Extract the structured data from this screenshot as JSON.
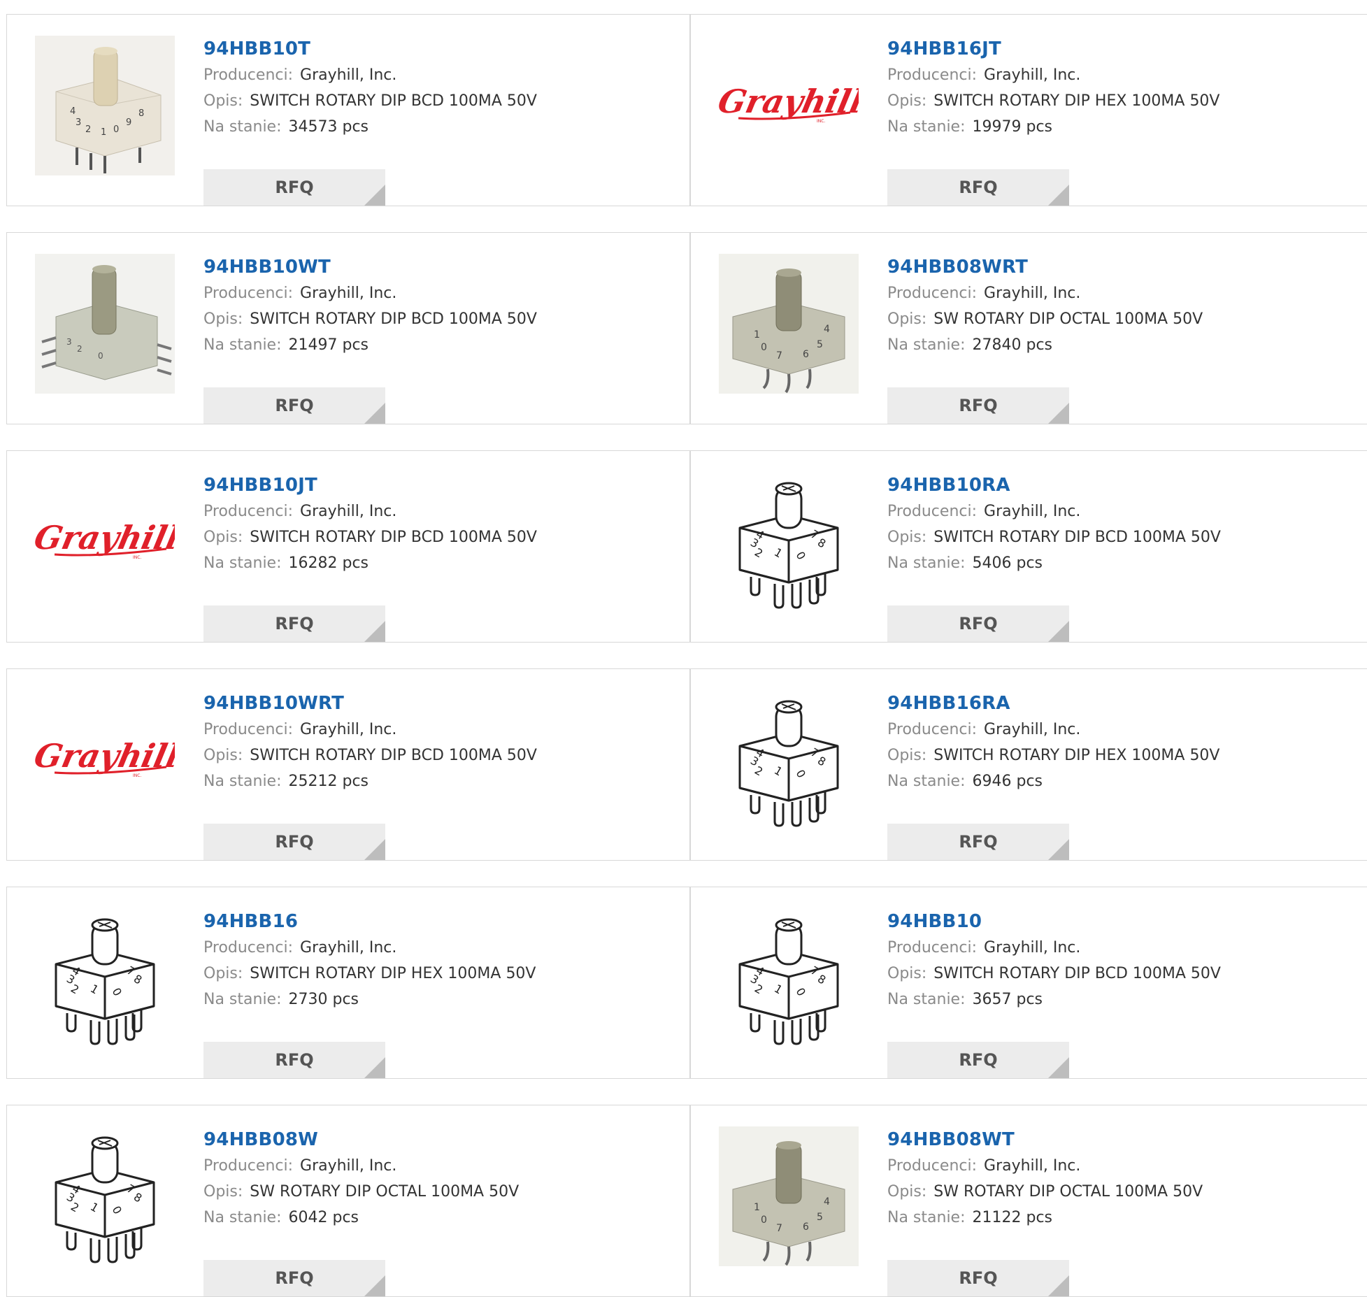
{
  "labels": {
    "manufacturer": "Producenci:",
    "description": "Opis:",
    "stock": "Na stanie:",
    "rfq": "RFQ"
  },
  "products": [
    {
      "part": "94HBB10T",
      "manufacturer": "Grayhill, Inc.",
      "description": "SWITCH ROTARY DIP BCD 100MA 50V",
      "stock": "34573 pcs",
      "image": "photo-beige-switch"
    },
    {
      "part": "94HBB16JT",
      "manufacturer": "Grayhill, Inc.",
      "description": "SWITCH ROTARY DIP HEX 100MA 50V",
      "stock": "19979 pcs",
      "image": "grayhill-logo"
    },
    {
      "part": "94HBB10WT",
      "manufacturer": "Grayhill, Inc.",
      "description": "SWITCH ROTARY DIP BCD 100MA 50V",
      "stock": "21497 pcs",
      "image": "photo-gray-smd-switch"
    },
    {
      "part": "94HBB08WRT",
      "manufacturer": "Grayhill, Inc.",
      "description": "SW ROTARY DIP OCTAL 100MA 50V",
      "stock": "27840 pcs",
      "image": "photo-gray-switch"
    },
    {
      "part": "94HBB10JT",
      "manufacturer": "Grayhill, Inc.",
      "description": "SWITCH ROTARY DIP BCD 100MA 50V",
      "stock": "16282 pcs",
      "image": "grayhill-logo"
    },
    {
      "part": "94HBB10RA",
      "manufacturer": "Grayhill, Inc.",
      "description": "SWITCH ROTARY DIP BCD 100MA 50V",
      "stock": "5406 pcs",
      "image": "line-drawing-switch"
    },
    {
      "part": "94HBB10WRT",
      "manufacturer": "Grayhill, Inc.",
      "description": "SWITCH ROTARY DIP BCD 100MA 50V",
      "stock": "25212 pcs",
      "image": "grayhill-logo"
    },
    {
      "part": "94HBB16RA",
      "manufacturer": "Grayhill, Inc.",
      "description": "SWITCH ROTARY DIP HEX 100MA 50V",
      "stock": "6946 pcs",
      "image": "line-drawing-switch"
    },
    {
      "part": "94HBB16",
      "manufacturer": "Grayhill, Inc.",
      "description": "SWITCH ROTARY DIP HEX 100MA 50V",
      "stock": "2730 pcs",
      "image": "line-drawing-switch"
    },
    {
      "part": "94HBB10",
      "manufacturer": "Grayhill, Inc.",
      "description": "SWITCH ROTARY DIP BCD 100MA 50V",
      "stock": "3657 pcs",
      "image": "line-drawing-switch"
    },
    {
      "part": "94HBB08W",
      "manufacturer": "Grayhill, Inc.",
      "description": "SW ROTARY DIP OCTAL 100MA 50V",
      "stock": "6042 pcs",
      "image": "line-drawing-switch"
    },
    {
      "part": "94HBB08WT",
      "manufacturer": "Grayhill, Inc.",
      "description": "SW ROTARY DIP OCTAL 100MA 50V",
      "stock": "21122 pcs",
      "image": "photo-gray-switch"
    }
  ],
  "logo_text": "Grayhill",
  "colors": {
    "part_link": "#1a64ad",
    "label": "#8a8a8a",
    "value": "#333333",
    "rfq_bg": "#ececec",
    "logo_red": "#e0202a"
  }
}
